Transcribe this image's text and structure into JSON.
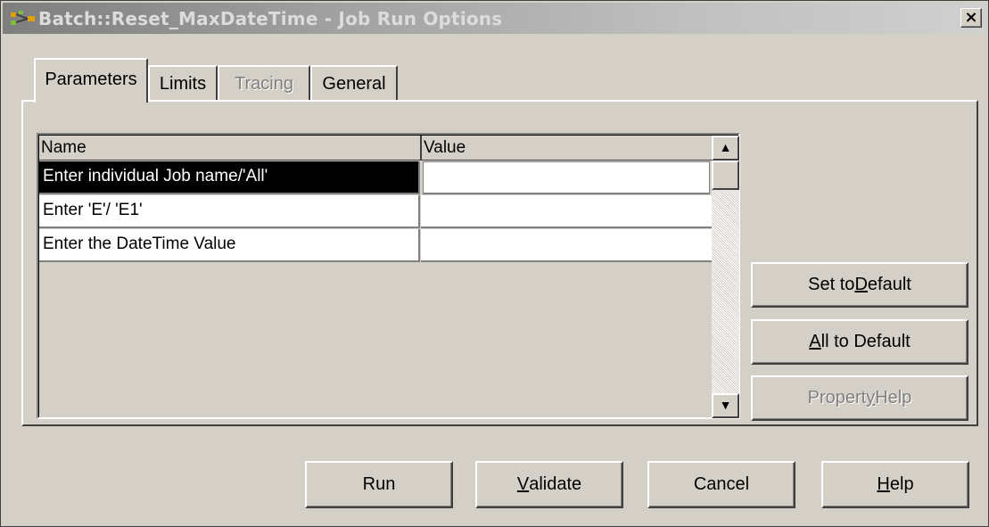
{
  "window": {
    "title": "Batch::Reset_MaxDateTime - Job Run Options",
    "close_label": "×"
  },
  "tabs": [
    {
      "label": "Parameters",
      "active": true,
      "enabled": true
    },
    {
      "label": "Limits",
      "active": false,
      "enabled": true
    },
    {
      "label": "Tracing",
      "active": false,
      "enabled": false
    },
    {
      "label": "General",
      "active": false,
      "enabled": true
    }
  ],
  "grid": {
    "columns": [
      "Name",
      "Value"
    ],
    "rows": [
      {
        "name": "Enter individual Job name/'All'",
        "value": "",
        "selected": true
      },
      {
        "name": "Enter 'E'/ 'E1'",
        "value": "",
        "selected": false
      },
      {
        "name": "Enter the DateTime Value",
        "value": "",
        "selected": false
      }
    ],
    "scroll_up_icon": "▲",
    "scroll_down_icon": "▼"
  },
  "side_buttons": {
    "set_default": {
      "pre": "Set to ",
      "key": "D",
      "post": "efault",
      "enabled": true
    },
    "all_default": {
      "pre": "",
      "key": "A",
      "post": "ll to Default",
      "enabled": true
    },
    "property_help": {
      "pre": "Propert",
      "key": "y",
      "post": " Help",
      "enabled": false
    }
  },
  "bottom_buttons": {
    "run": {
      "pre": "Run",
      "key": "",
      "post": ""
    },
    "validate": {
      "pre": "",
      "key": "V",
      "post": "alidate"
    },
    "cancel": {
      "pre": "Cancel",
      "key": "",
      "post": ""
    },
    "help": {
      "pre": "",
      "key": "H",
      "post": "elp"
    }
  },
  "colors": {
    "dialog_bg": "#d4d0c8",
    "selection_bg": "#000000",
    "selection_fg": "#ffffff",
    "disabled_text": "#808080"
  }
}
